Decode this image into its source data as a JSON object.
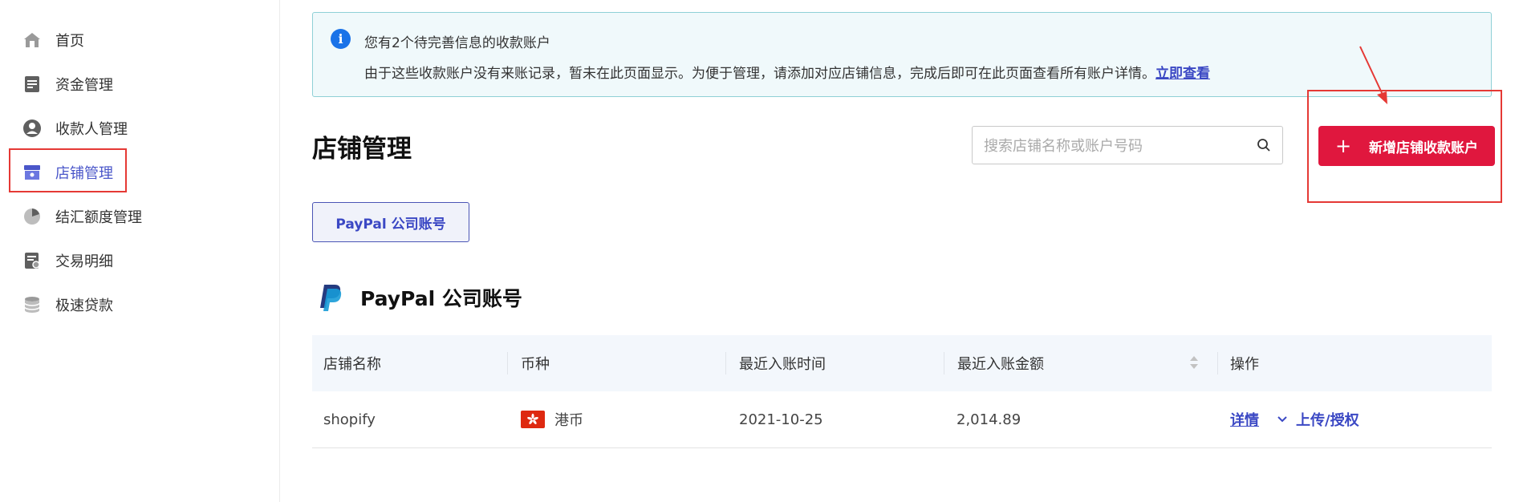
{
  "sidebar": {
    "items": [
      {
        "label": "首页",
        "icon": "home-icon"
      },
      {
        "label": "资金管理",
        "icon": "document-icon"
      },
      {
        "label": "收款人管理",
        "icon": "user-icon"
      },
      {
        "label": "店铺管理",
        "icon": "store-icon",
        "active": true
      },
      {
        "label": "结汇额度管理",
        "icon": "pie-chart-icon"
      },
      {
        "label": "交易明细",
        "icon": "report-icon"
      },
      {
        "label": "极速贷款",
        "icon": "database-icon"
      }
    ]
  },
  "notice": {
    "title": "您有2个待完善信息的收款账户",
    "body": "由于这些收款账户没有来账记录，暂未在此页面显示。为便于管理，请添加对应店铺信息，完成后即可在此页面查看所有账户详情。",
    "link": "立即查看"
  },
  "page": {
    "title": "店铺管理",
    "search_placeholder": "搜索店铺名称或账户号码",
    "add_button": "新增店铺收款账户",
    "add_button_icon": "+"
  },
  "tabs": [
    {
      "label": "PayPal 公司账号"
    }
  ],
  "section": {
    "title": "PayPal 公司账号"
  },
  "table": {
    "columns": [
      "店铺名称",
      "币种",
      "最近入账时间",
      "最近入账金额",
      "操作"
    ],
    "rows": [
      {
        "store": "shopify",
        "currency": "港币",
        "last_time": "2021-10-25",
        "last_amount": "2,014.89",
        "action_detail": "详情",
        "action_upload": "上传/授权"
      }
    ]
  },
  "colors": {
    "accent": "#3b48c4",
    "primary_button": "#e0173e",
    "annotation_red": "#e53935",
    "notice_bg": "#f0f9fb",
    "notice_border": "#8fd0d6"
  }
}
